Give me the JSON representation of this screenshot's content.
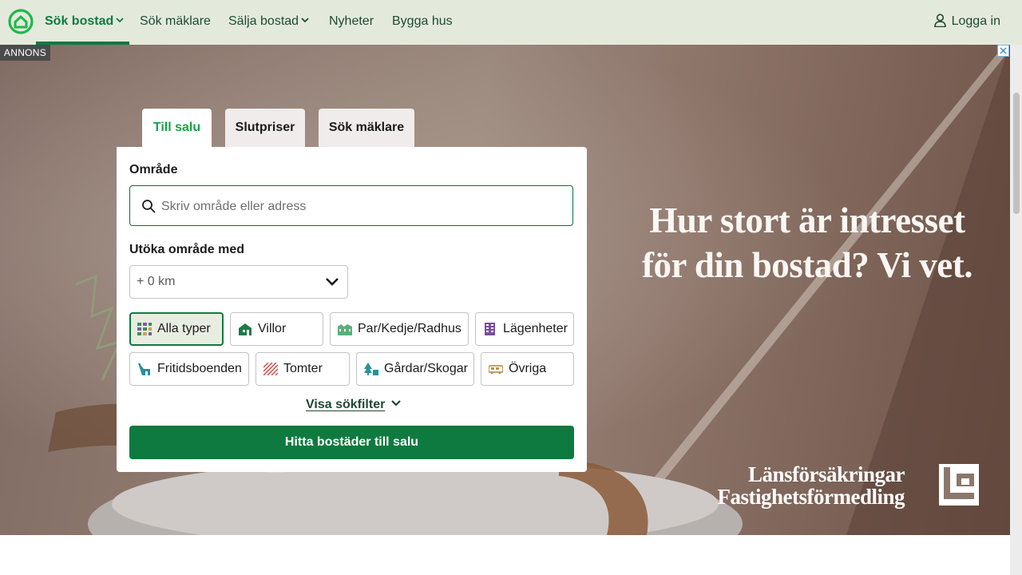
{
  "nav": {
    "items": [
      {
        "label": "Sök bostad",
        "has_dropdown": true,
        "active": true
      },
      {
        "label": "Sök mäklare",
        "has_dropdown": false,
        "active": false
      },
      {
        "label": "Sälja bostad",
        "has_dropdown": true,
        "active": false
      },
      {
        "label": "Nyheter",
        "has_dropdown": false,
        "active": false
      },
      {
        "label": "Bygga hus",
        "has_dropdown": false,
        "active": false
      }
    ],
    "login_label": "Logga in",
    "login_icon": "user-icon",
    "logo_icon": "house-logo-icon"
  },
  "ad": {
    "badge": "ANNONS",
    "headline_line1": "Hur stort är intresset",
    "headline_line2": "för din bostad? Vi vet.",
    "brand_line1": "Länsförsäkringar",
    "brand_line2": "Fastighetsförmedling"
  },
  "tabs": [
    {
      "label": "Till salu",
      "active": true
    },
    {
      "label": "Slutpriser",
      "active": false
    },
    {
      "label": "Sök mäklare",
      "active": false
    }
  ],
  "search": {
    "area_label": "Område",
    "area_placeholder": "Skriv område eller adress",
    "area_value": "",
    "expand_label": "Utöka område med",
    "expand_value": "+ 0 km",
    "types": [
      {
        "label": "Alla typer",
        "icon": "grid-icon",
        "selected": true
      },
      {
        "label": "Villor",
        "icon": "villa-icon",
        "selected": false
      },
      {
        "label": "Par/Kedje/Radhus",
        "icon": "rowhouse-icon",
        "selected": false
      },
      {
        "label": "Lägenheter",
        "icon": "apartment-icon",
        "selected": false
      },
      {
        "label": "Fritidsboenden",
        "icon": "cottage-icon",
        "selected": false
      },
      {
        "label": "Tomter",
        "icon": "plot-icon",
        "selected": false
      },
      {
        "label": "Gårdar/Skogar",
        "icon": "farm-icon",
        "selected": false
      },
      {
        "label": "Övriga",
        "icon": "other-icon",
        "selected": false
      }
    ],
    "filter_link": "Visa sökfilter",
    "submit_label": "Hitta bostäder till salu"
  },
  "colors": {
    "brand_green": "#0e7a3f",
    "nav_bg": "#e3eadc",
    "active_tab_text": "#16a34a"
  }
}
